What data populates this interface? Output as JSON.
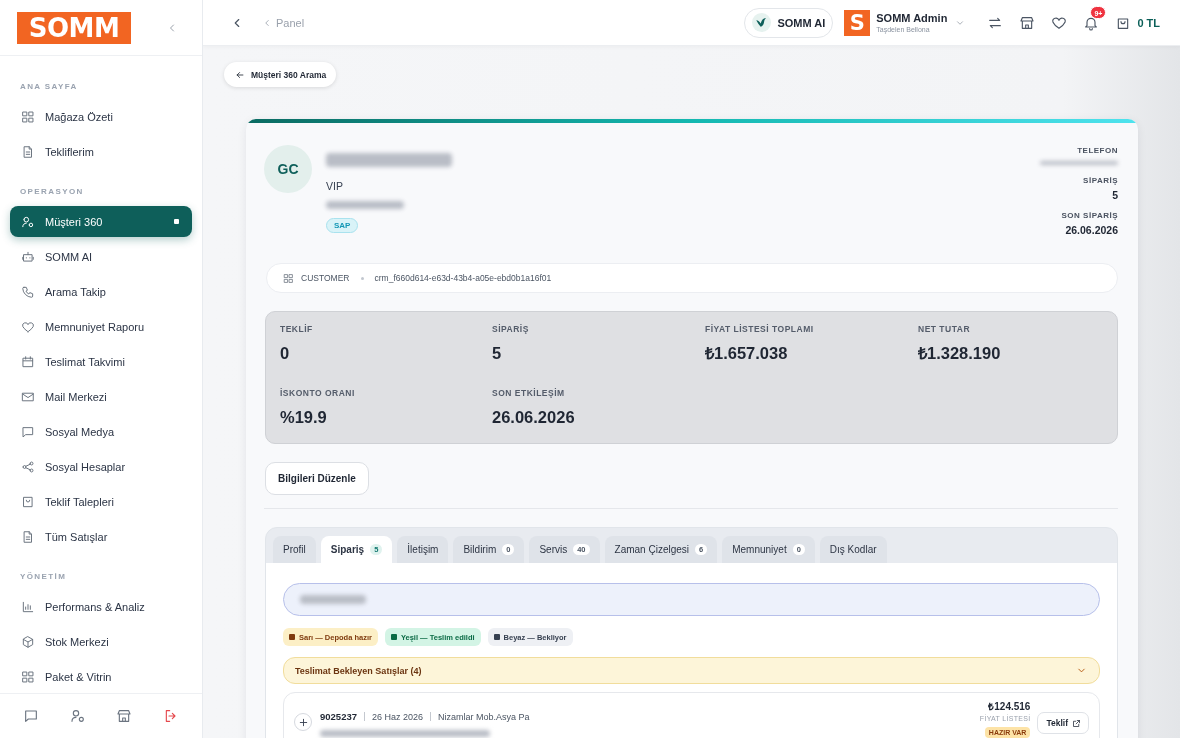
{
  "sidebar": {
    "logo": "SOMM",
    "sections": [
      {
        "title": "ANA SAYFA",
        "items": [
          {
            "label": "Mağaza Özeti",
            "selected": false
          },
          {
            "label": "Tekliflerim",
            "selected": false
          }
        ]
      },
      {
        "title": "OPERASYON",
        "items": [
          {
            "label": "Müşteri 360",
            "selected": true
          },
          {
            "label": "SOMM AI",
            "selected": false
          },
          {
            "label": "Arama Takip",
            "selected": false
          },
          {
            "label": "Memnuniyet Raporu",
            "selected": false
          },
          {
            "label": "Teslimat Takvimi",
            "selected": false
          },
          {
            "label": "Mail Merkezi",
            "selected": false
          },
          {
            "label": "Sosyal Medya",
            "selected": false
          },
          {
            "label": "Sosyal Hesaplar",
            "selected": false
          },
          {
            "label": "Teklif Talepleri",
            "selected": false
          },
          {
            "label": "Tüm Satışlar",
            "selected": false
          }
        ]
      },
      {
        "title": "YÖNETİM",
        "items": [
          {
            "label": "Performans & Analiz",
            "selected": false
          },
          {
            "label": "Stok Merkezi",
            "selected": false
          },
          {
            "label": "Paket & Vitrin",
            "selected": false
          }
        ]
      }
    ]
  },
  "topbar": {
    "breadcrumb": "Panel",
    "ai_button": "SOMM AI",
    "user": {
      "logo": "S",
      "name": "SOMM Admin",
      "subtitle": "Taşdelen Bellona"
    },
    "notification_count": "9+",
    "cart_total": "0 TL"
  },
  "back_button": "Müşteri 360 Arama",
  "customer": {
    "initials": "GC",
    "segment": "VIP",
    "tags": [
      "SAP"
    ],
    "details": [
      {
        "label": "TELEFON"
      },
      {
        "label": "SİPARİŞ",
        "value": "5"
      },
      {
        "label": "SON SİPARİŞ",
        "value": "26.06.2026"
      }
    ],
    "record": {
      "type": "CUSTOMER",
      "id": "crm_f660d614-e63d-43b4-a05e-ebd0b1a16f01"
    },
    "stats": [
      {
        "label": "TEKLİF",
        "value": "0"
      },
      {
        "label": "SİPARİŞ",
        "value": "5"
      },
      {
        "label": "FİYAT LİSTESİ TOPLAMI",
        "value": "₺1.657.038"
      },
      {
        "label": "NET TUTAR",
        "value": "₺1.328.190"
      },
      {
        "label": "İSKONTO ORANI",
        "value": "%19.9"
      },
      {
        "label": "SON ETKİLEŞİM",
        "value": "26.06.2026"
      }
    ],
    "edit_button": "Bilgileri Düzenle"
  },
  "tabs": [
    {
      "label": "Profil",
      "selected": false
    },
    {
      "label": "Sipariş",
      "count": "5",
      "selected": true
    },
    {
      "label": "İletişim",
      "selected": false
    },
    {
      "label": "Bildirim",
      "count": "0",
      "selected": false
    },
    {
      "label": "Servis",
      "count": "40",
      "selected": false
    },
    {
      "label": "Zaman Çizelgesi",
      "count": "6",
      "selected": false
    },
    {
      "label": "Memnuniyet",
      "count": "0",
      "selected": false
    },
    {
      "label": "Dış Kodlar",
      "selected": false
    }
  ],
  "orders": {
    "legend": [
      {
        "label": "Sarı — Depoda hazır",
        "color": "#7f3a0e"
      },
      {
        "label": "Yeşil — Teslim edildi",
        "color": "#0b6b45"
      },
      {
        "label": "Beyaz — Bekliyor",
        "color": "#374151"
      }
    ],
    "section": {
      "title": "Teslimat Bekleyen Satışlar (4)",
      "expanded": false
    },
    "rows": [
      {
        "number": "9025237",
        "date": "26 Haz 2026",
        "store": "Nizamlar Mob.Asya Pa",
        "amount": "₺124.516",
        "amount_label": "FİYAT LİSTESİ",
        "status": "HAZIR VAR",
        "action": "Teklif"
      }
    ]
  }
}
